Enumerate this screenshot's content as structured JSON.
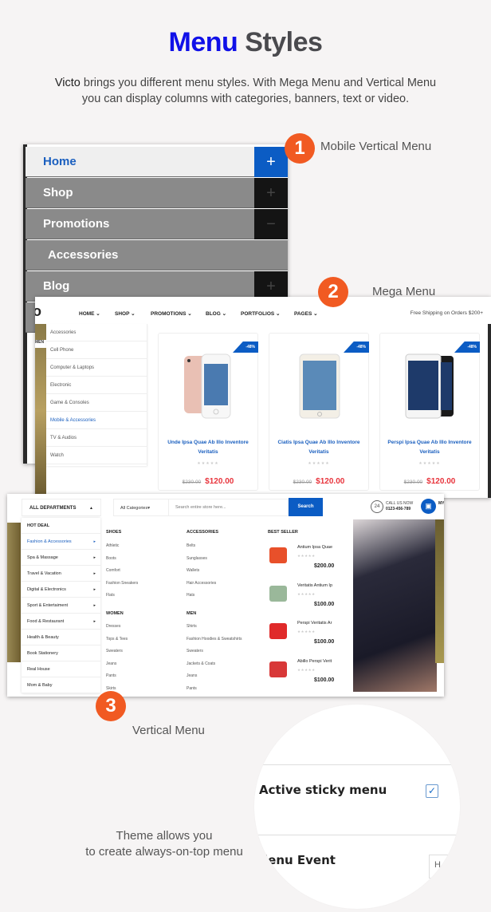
{
  "header": {
    "title_accent": "Menu",
    "title_rest": "Styles",
    "brand": "Victo",
    "intro_line1": " brings you different menu styles. With Mega Menu and Vertical Menu",
    "intro_line2": "you can display columns with categories, banners, text or video."
  },
  "colors": {
    "accent_blue": "#1010e8",
    "badge_orange": "#f15a22",
    "ui_blue": "#0b5cc4",
    "price_red": "#e8343c"
  },
  "sections": [
    {
      "number": "1",
      "caption": "Mobile Vertical Menu"
    },
    {
      "number": "2",
      "caption": "Mega Menu"
    },
    {
      "number": "3",
      "caption": "Vertical Menu"
    }
  ],
  "mobile_menu": {
    "items": [
      {
        "label": "Home",
        "toggle": "+",
        "active": true
      },
      {
        "label": "Shop",
        "toggle": "+"
      },
      {
        "label": "Promotions",
        "toggle": "−"
      },
      {
        "label": "Accessories",
        "toggle": ""
      },
      {
        "label": "Blog",
        "toggle": "+"
      }
    ]
  },
  "mega_menu": {
    "logo_fragment": "o",
    "nav": [
      "HOME ⌄",
      "SHOP ⌄",
      "PROMOTIONS ⌄",
      "BLOG ⌄",
      "PORTFOLIOS ⌄",
      "PAGES ⌄"
    ],
    "shipping_note": "Free Shipping on Orders $200+",
    "menu_fragment": "MEN",
    "categories": [
      "Accessories",
      "Cell Phone",
      "Computer & Laptops",
      "Electronic",
      "Game & Consoles",
      "Mobile & Accessories",
      "TV & Audios",
      "Watch"
    ],
    "active_category": "Mobile & Accessories",
    "products": [
      {
        "name": "Unde Ipsa Quae Ab Illo Inventore Veritatis",
        "discount": "-48%",
        "old_price": "$230.00",
        "price": "$120.00",
        "stars": "★★★★★"
      },
      {
        "name": "Ciatis Ipsa Quae Ab Illo Inventore Veritatis",
        "discount": "-48%",
        "old_price": "$230.00",
        "price": "$120.00",
        "stars": "★★★★★"
      },
      {
        "name": "Perspi Ipsa Quae Ab Illo Inventore Veritatis",
        "discount": "-48%",
        "old_price": "$230.00",
        "price": "$120.00",
        "stars": "★★★★★"
      }
    ]
  },
  "vertical_menu": {
    "departments_label": "ALL DEPARTMENTS",
    "departments_caret": "▲",
    "category_select": "All Categories▾",
    "search_placeholder": "Search entire store here...",
    "search_button": "Search",
    "call_label": "CALL US NOW",
    "call_number": "0123-456-789",
    "phone_icon_text": "24",
    "my_label": "MY",
    "items": [
      {
        "label": "HOT DEAL",
        "arrow": ""
      },
      {
        "label": "Fashion & Accessories",
        "arrow": "▸"
      },
      {
        "label": "Spa & Massage",
        "arrow": "▸"
      },
      {
        "label": "Travel & Vacation",
        "arrow": "▸"
      },
      {
        "label": "Digital & Electronics",
        "arrow": "▸"
      },
      {
        "label": "Sport & Entertaiment",
        "arrow": "▸"
      },
      {
        "label": "Food & Restaurant",
        "arrow": "▸"
      },
      {
        "label": "Health & Beauty",
        "arrow": ""
      },
      {
        "label": "Book Stationery",
        "arrow": ""
      },
      {
        "label": "Real House",
        "arrow": ""
      },
      {
        "label": "Mom & Baby",
        "arrow": ""
      }
    ],
    "columns": {
      "shoes": {
        "heading": "SHOES",
        "links": [
          "Athletic",
          "Boots",
          "Comfort",
          "Fashion Sneakers",
          "Flats"
        ]
      },
      "women": {
        "heading": "WOMEN",
        "links": [
          "Dresses",
          "Tops & Tees",
          "Sweaters",
          "Jeans",
          "Pants",
          "Skirts"
        ]
      },
      "accessories": {
        "heading": "ACCESSORIES",
        "links": [
          "Belts",
          "Sunglasses",
          "Wallets",
          "Hair Accessories",
          "Hats"
        ]
      },
      "men": {
        "heading": "MEN",
        "links": [
          "Shirts",
          "Fashion Hoodies & Sweatshirts",
          "Sweaters",
          "Jackets & Coats",
          "Jeans",
          "Pants"
        ]
      }
    },
    "best_seller": {
      "heading": "BEST SELLER",
      "items": [
        {
          "name": "Antium Ipsa Quae",
          "stars": "★★★★★",
          "price": "$200.00"
        },
        {
          "name": "Veritatis Antium Ip",
          "stars": "★★★★★",
          "price": "$100.00"
        },
        {
          "name": "Perspi Veritatis Ar",
          "stars": "★★★★★",
          "price": "$100.00"
        },
        {
          "name": "Abillo Perspi Verit",
          "stars": "★★★★★",
          "price": "$100.00"
        }
      ]
    }
  },
  "sticky": {
    "label": "Active sticky menu",
    "checked": "✓",
    "event_label": "lenu Event",
    "event_value": "H",
    "desc_line1": "Theme allows you",
    "desc_line2": "to create always-on-top menu"
  }
}
